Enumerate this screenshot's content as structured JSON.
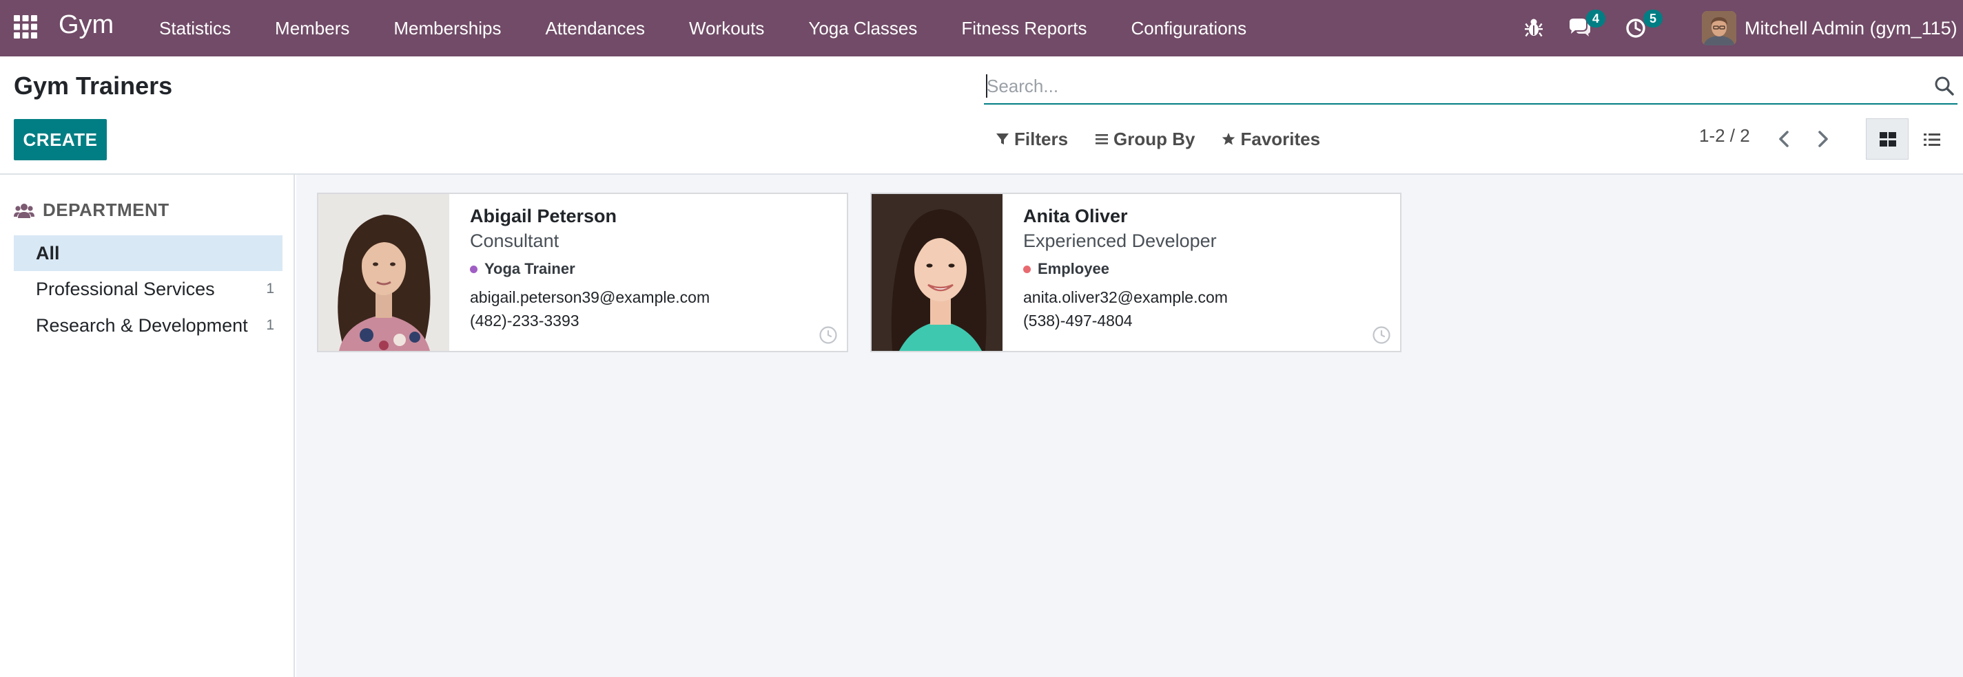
{
  "navbar": {
    "brand": "Gym",
    "menu": [
      "Statistics",
      "Members",
      "Memberships",
      "Attendances",
      "Workouts",
      "Yoga Classes",
      "Fitness Reports",
      "Configurations"
    ],
    "messages_count": "4",
    "activities_count": "5",
    "user_name": "Mitchell Admin (gym_115)"
  },
  "control_panel": {
    "title": "Gym Trainers",
    "create_label": "CREATE",
    "search_placeholder": "Search...",
    "filters_label": "Filters",
    "group_by_label": "Group By",
    "favorites_label": "Favorites",
    "pager_value": "1-2 / 2"
  },
  "sidebar": {
    "header": "DEPARTMENT",
    "items": [
      {
        "label": "All",
        "count": ""
      },
      {
        "label": "Professional Services",
        "count": "1"
      },
      {
        "label": "Research & Development",
        "count": "1"
      }
    ]
  },
  "cards": [
    {
      "name": "Abigail Peterson",
      "job": "Consultant",
      "tag": "Yoga Trainer",
      "tag_color": "#a05ec5",
      "email": "abigail.peterson39@example.com",
      "phone": "(482)-233-3393"
    },
    {
      "name": "Anita Oliver",
      "job": "Experienced Developer",
      "tag": "Employee",
      "tag_color": "#e86a70",
      "email": "anita.oliver32@example.com",
      "phone": "(538)-497-4804"
    }
  ],
  "colors": {
    "navbar": "#714b67",
    "primary": "#017e84",
    "kanban_bg": "#f4f5f9",
    "sidebar_active": "#d9e8f5"
  },
  "icons": {
    "apps": "grid-icon",
    "debug": "bug-icon",
    "messages": "chat-icon",
    "activities": "clock-icon",
    "search": "search-icon",
    "filters": "filter-icon",
    "group_by": "bars-icon",
    "favorites": "star-icon",
    "department": "users-icon",
    "activity": "clock-outline-icon"
  }
}
